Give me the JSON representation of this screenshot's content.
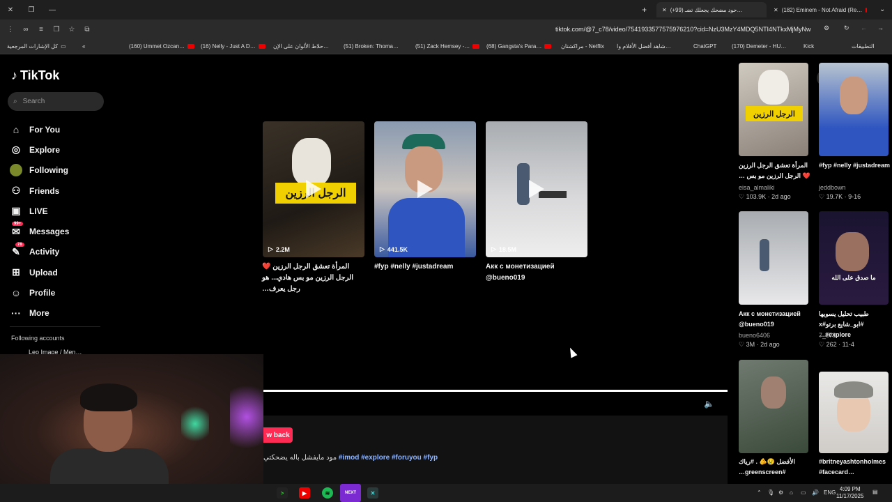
{
  "browser": {
    "tabs": [
      {
        "label": "(+99) حود مضحك يجعلك تضـ…",
        "active": true
      },
      {
        "label": "(182) Eminem - Not Afraid (Re…",
        "active": false
      }
    ],
    "url": "tiktok.com/@7_c78/video/7541933577575976210?cid=NzU3MzY4MDQ5NTI4NTkxMjMyNw",
    "bookmarks": [
      "كل الإشارات المرجعية",
      "(160) Ummet Ozcan…",
      "(16) Nelly - Just A D…",
      "حلاط الألوان على الإن…",
      "(51) Broken: Thoma…",
      "(51) Zack Hemsey -…",
      "(68) Gangsta's Para…",
      "مراكشتان - Netflix",
      "شاهد أفضل الأفلام وا…",
      "ChatGPT",
      "(170) Demeter - HU…",
      "Kick",
      "التطبيقات"
    ]
  },
  "sidebar": {
    "logo": "TikTok",
    "search_placeholder": "Search",
    "items": [
      {
        "label": "For You",
        "icon": "home-icon"
      },
      {
        "label": "Explore",
        "icon": "compass-icon"
      },
      {
        "label": "Following",
        "icon": "following-avatar-icon"
      },
      {
        "label": "Friends",
        "icon": "friends-icon"
      },
      {
        "label": "LIVE",
        "icon": "live-icon"
      },
      {
        "label": "Messages",
        "icon": "messages-icon",
        "badge": "99+"
      },
      {
        "label": "Activity",
        "icon": "activity-icon",
        "badge": "78"
      },
      {
        "label": "Upload",
        "icon": "upload-icon"
      },
      {
        "label": "Profile",
        "icon": "profile-icon"
      },
      {
        "label": "More",
        "icon": "more-icon"
      }
    ],
    "following_title": "Following accounts",
    "following_first": "Leo Image / Men…"
  },
  "grid": [
    {
      "views": "2.2M",
      "caption": "المرأة تعشق الرجل الرزين ❤️ الرجل الرزين مو بس هادي... هو رجل يعرف…",
      "thumb_text": "الرجل الرزين"
    },
    {
      "views": "441.5K",
      "caption": "#fyp #nelly #justadream",
      "thumb_text": ""
    },
    {
      "views": "18.5M",
      "caption": "Акк с монетизацией @bueno019",
      "thumb_text": ""
    }
  ],
  "player": {
    "back_label": "w back",
    "description": "مود مايفشل باله يضحكتي",
    "tags": "#imod #explore #foruyou #fyp"
  },
  "related": [
    {
      "caption": "المرأة تعشق الرجل الرزين ❤️ الرجل الرزين مو بس …",
      "author": "eisa_almaliki",
      "stats": "♡ 103.9K · 2d ago",
      "thumb_text": "الرجل الرزين"
    },
    {
      "caption": "#fyp #nelly #justadream",
      "author": "jeddbown",
      "stats": "♡ 19.7K · 9-16",
      "thumb_text": ""
    },
    {
      "caption": "Акк с монетизацией @bueno019",
      "author": "bueno6406",
      "stats": "♡ 3M · 2d ago",
      "thumb_text": ""
    },
    {
      "caption": "طبيب تحليل يسويها #ابو_شايع برتو#x #explore…",
      "author": "7_c78",
      "stats": "♡ 262 · 11-4",
      "thumb_text": "ما صدق على الله"
    },
    {
      "caption": "الأفضل 😢🫵 . #رياك #greenscreen…",
      "author": "",
      "stats": "",
      "thumb_text": ""
    },
    {
      "caption": "#britneyashtonholmes #facecard…",
      "author": "",
      "stats": "",
      "thumb_text": ""
    }
  ],
  "taskbar": {
    "time": "4:09 PM",
    "date": "11/17/2025",
    "lang": "ENG"
  }
}
